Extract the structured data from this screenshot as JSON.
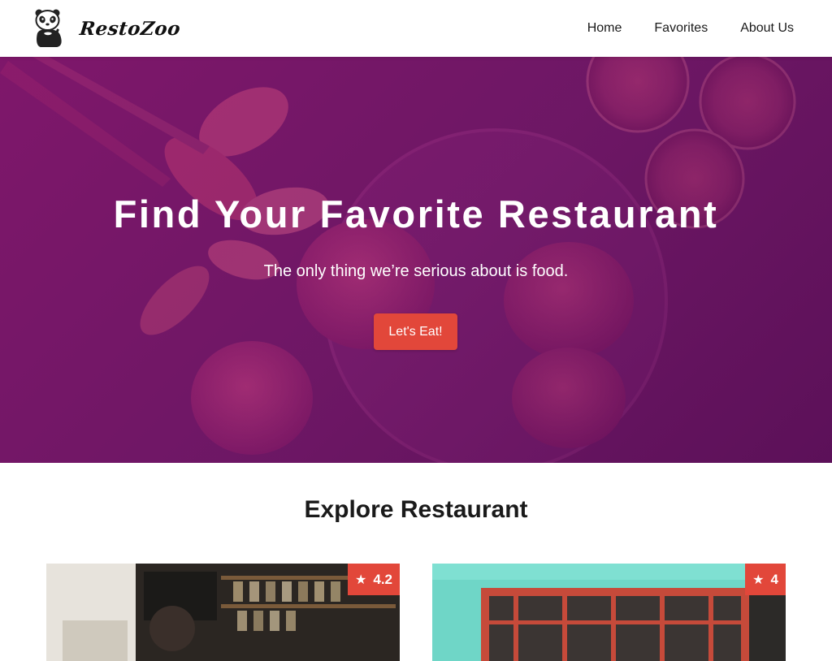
{
  "app": {
    "brand": "RestoZoo",
    "logo_icon": "panda-icon",
    "accent_color": "#e2473a",
    "hero_tint": "#7b1a6e"
  },
  "nav": {
    "items": [
      {
        "label": "Home"
      },
      {
        "label": "Favorites"
      },
      {
        "label": "About Us"
      }
    ]
  },
  "hero": {
    "title": "Find Your Favorite Restaurant",
    "subtitle": "The only thing we’re serious about is food.",
    "cta_label": "Let's Eat!"
  },
  "explore": {
    "title": "Explore Restaurant",
    "restaurants": [
      {
        "rating": "4.2",
        "star_icon": "star-icon"
      },
      {
        "rating": "4",
        "star_icon": "star-icon"
      }
    ]
  }
}
